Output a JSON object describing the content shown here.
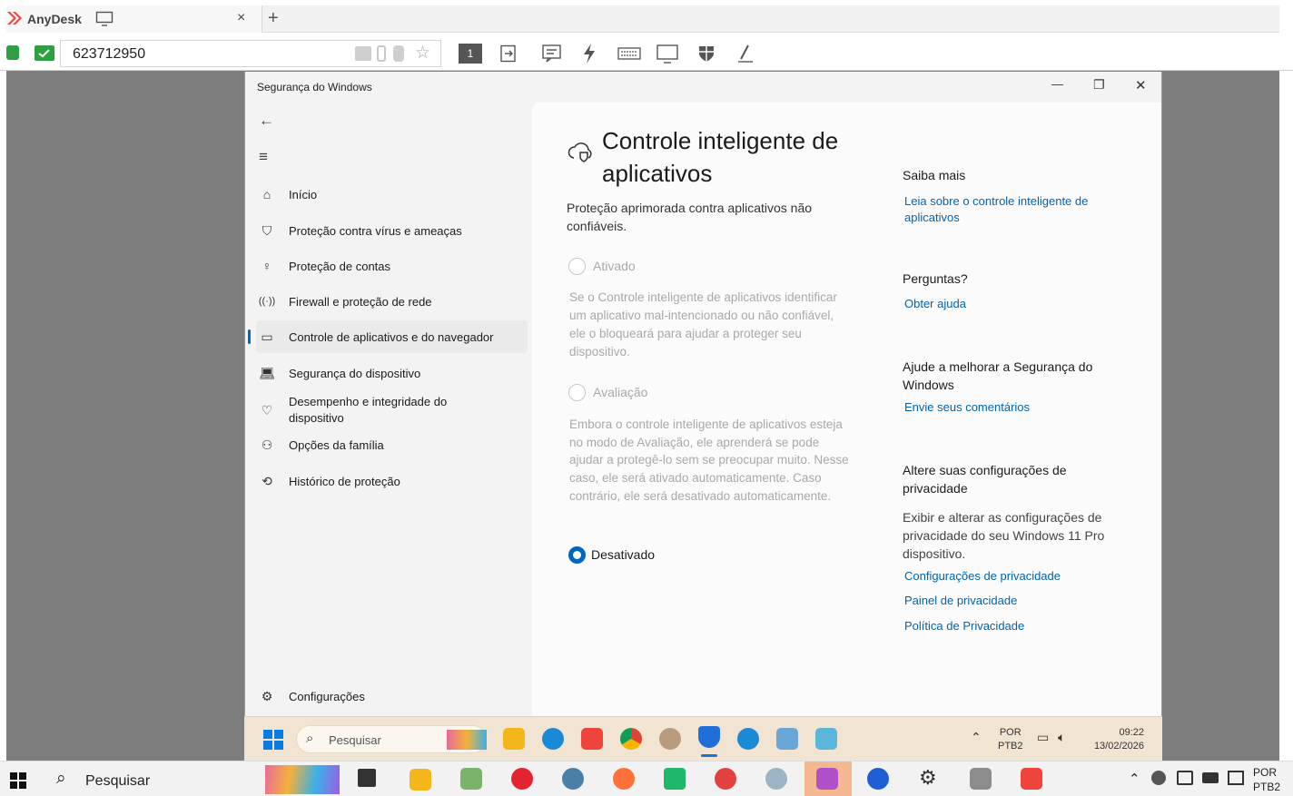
{
  "anydesk": {
    "tab_title": "AnyDesk",
    "address_id": "623712950",
    "monitor_number": "1",
    "colors": {
      "brand": "#ef443b",
      "status_ok": "#2ea043"
    }
  },
  "window": {
    "title": "Segurança do Windows",
    "minimize": "—",
    "restore": "❐",
    "close": "✕"
  },
  "sidebar": {
    "items": [
      {
        "label": "Início",
        "icon": "home-icon"
      },
      {
        "label": "Proteção contra vírus e ameaças",
        "icon": "shield-icon"
      },
      {
        "label": "Proteção de contas",
        "icon": "person-icon"
      },
      {
        "label": "Firewall e proteção de rede",
        "icon": "antenna-icon"
      },
      {
        "label": "Controle de aplicativos e do navegador",
        "icon": "app-window-icon"
      },
      {
        "label": "Segurança do dispositivo",
        "icon": "laptop-icon"
      },
      {
        "label": "Desempenho e integridade do dispositivo",
        "icon": "heart-pulse-icon"
      },
      {
        "label": "Opções da família",
        "icon": "family-icon"
      },
      {
        "label": "Histórico de proteção",
        "icon": "history-icon"
      }
    ],
    "settings": "Configurações"
  },
  "main": {
    "title_line1": "Controle inteligente de",
    "title_line2": "aplicativos",
    "description": "Proteção aprimorada contra aplicativos não confiáveis.",
    "options": [
      {
        "label": "Ativado",
        "selected": false,
        "desc": "Se o Controle inteligente de aplicativos identificar um aplicativo mal-intencionado ou não confiável, ele o bloqueará para ajudar a proteger seu dispositivo."
      },
      {
        "label": "Avaliação",
        "selected": false,
        "desc": "Embora o controle inteligente de aplicativos esteja no modo de Avaliação, ele aprenderá se pode ajudar a protegê-lo sem se preocupar muito. Nesse caso, ele será ativado automaticamente. Caso contrário, ele será desativado automaticamente."
      },
      {
        "label": "Desativado",
        "selected": true,
        "desc": ""
      }
    ]
  },
  "right": {
    "saiba_mais": "Saiba mais",
    "saiba_link": "Leia sobre o controle inteligente de aplicativos",
    "perguntas": "Perguntas?",
    "ajuda_link": "Obter ajuda",
    "melhorar": "Ajude a melhorar a Segurança do Windows",
    "comentarios_link": "Envie seus comentários",
    "privacidade_title": "Altere suas configurações de privacidade",
    "privacidade_desc": "Exibir e alterar as configurações de privacidade do seu Windows 11 Pro dispositivo.",
    "privacy_links": [
      "Configurações de privacidade",
      "Painel de privacidade",
      "Política de Privacidade"
    ]
  },
  "remote_taskbar": {
    "search": "Pesquisar",
    "lang_top": "POR",
    "lang_bottom": "PTB2",
    "time": "09:22",
    "date": "13/02/2026"
  },
  "local_taskbar": {
    "search": "Pesquisar",
    "lang_top": "POR",
    "lang_bottom": "PTB2"
  }
}
